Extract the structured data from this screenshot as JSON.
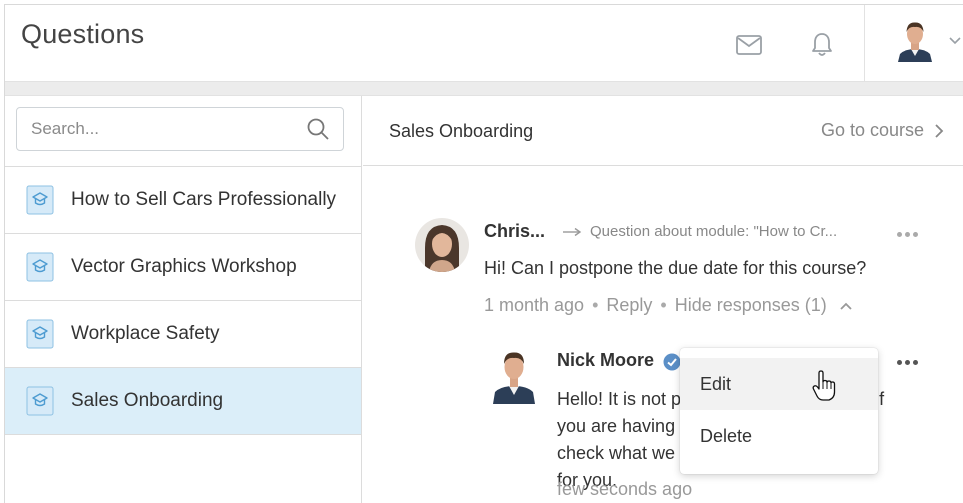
{
  "header": {
    "title": "Questions",
    "icons": [
      "mail-icon",
      "bell-icon",
      "chevron-down-icon"
    ]
  },
  "sidebar": {
    "search": {
      "placeholder": "Search...",
      "value": ""
    },
    "items": [
      {
        "label": "How to Sell Cars Professionally",
        "active": false
      },
      {
        "label": "Vector Graphics Workshop",
        "active": false
      },
      {
        "label": "Workplace Safety",
        "active": false
      },
      {
        "label": "Sales Onboarding",
        "active": true
      }
    ]
  },
  "main": {
    "course_title": "Sales Onboarding",
    "go_to_course": "Go to course",
    "question": {
      "author": "Chris...",
      "context": "Question about module: \"How to Cr...",
      "text": "Hi! Can I postpone the due date for this course?",
      "time": "1 month ago",
      "reply": "Reply",
      "hide_responses": "Hide responses (1)"
    },
    "response": {
      "author": "Nick Moore",
      "text": "Hello! It is not possible to change it, but if you are having an emergency, we can check what we can do with the due date for you.",
      "time": "few seconds ago"
    },
    "context_menu": {
      "edit": "Edit",
      "delete": "Delete"
    }
  },
  "colors": {
    "active_item": "#dbeef9",
    "verified_badge": "#5b8fc7",
    "muted_text": "#999999"
  }
}
